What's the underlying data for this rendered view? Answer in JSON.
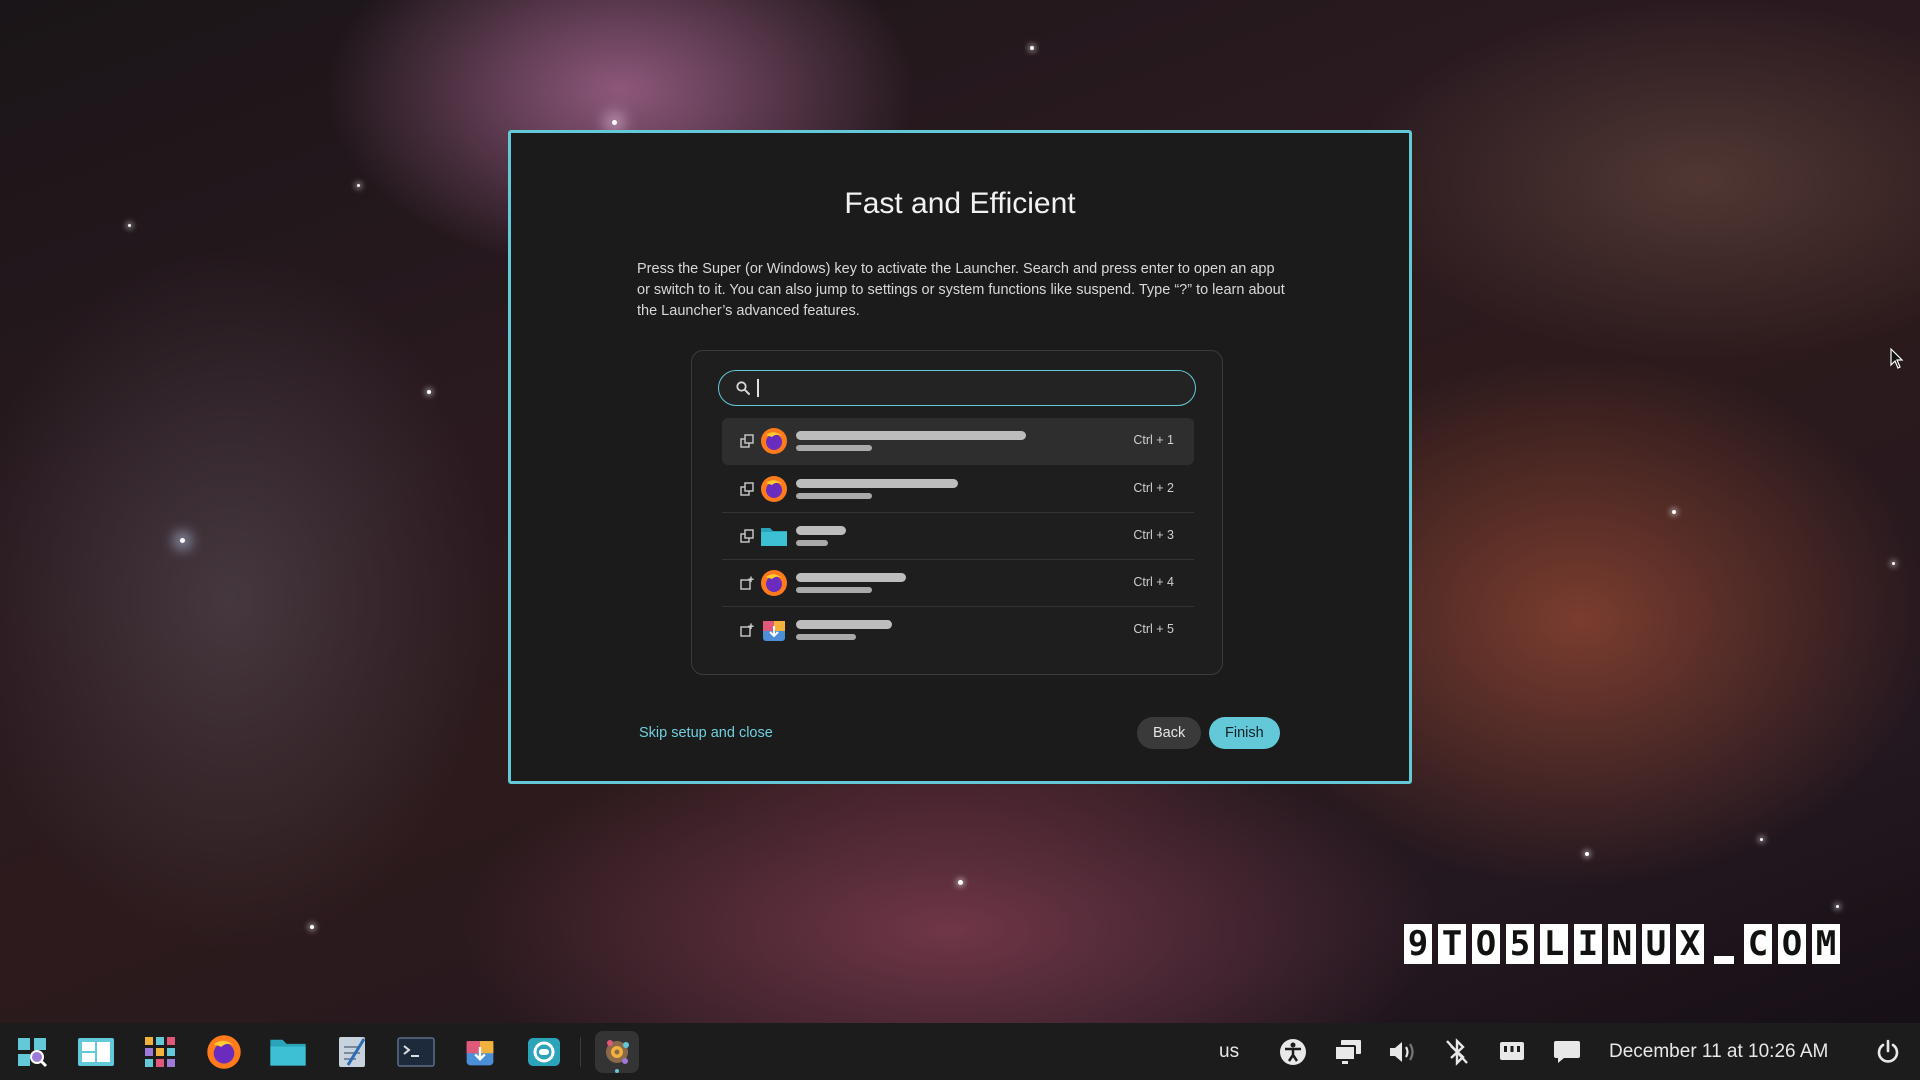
{
  "dialog": {
    "title": "Fast and Efficient",
    "description": "Press the Super (or Windows) key to activate the Launcher. Search and press enter to open an app or switch to it. You can also jump to settings or system functions like suspend. Type “?” to learn about the Launcher’s advanced features.",
    "search_placeholder": "",
    "results": [
      {
        "action_icon": "switch-window-icon",
        "app_icon": "firefox-icon",
        "shortcut": "Ctrl + 1"
      },
      {
        "action_icon": "switch-window-icon",
        "app_icon": "firefox-icon",
        "shortcut": "Ctrl + 2"
      },
      {
        "action_icon": "switch-window-icon",
        "app_icon": "folder-icon",
        "shortcut": "Ctrl + 3"
      },
      {
        "action_icon": "launch-icon",
        "app_icon": "firefox-icon",
        "shortcut": "Ctrl + 4"
      },
      {
        "action_icon": "launch-icon",
        "app_icon": "app-store-icon",
        "shortcut": "Ctrl + 5"
      }
    ],
    "skip_label": "Skip setup and close",
    "back_label": "Back",
    "finish_label": "Finish"
  },
  "watermark": {
    "text": "9TO5LINUX.COM"
  },
  "taskbar": {
    "apps": [
      "launcher-icon",
      "workspaces-icon",
      "app-library-icon",
      "firefox-icon",
      "files-icon",
      "text-editor-icon",
      "terminal-icon",
      "app-store-icon",
      "system-monitor-icon",
      "settings-icon"
    ],
    "keyboard_layout": "us",
    "clock": "December 11 at 10:26 AM",
    "tray": [
      "accessibility-icon",
      "displays-icon",
      "volume-icon",
      "bluetooth-off-icon",
      "network-icon",
      "notifications-icon",
      "power-icon"
    ]
  },
  "colors": {
    "accent": "#63c8d8",
    "dialog_bg": "#1b1b1b",
    "taskbar_bg": "#1c1c1c"
  }
}
